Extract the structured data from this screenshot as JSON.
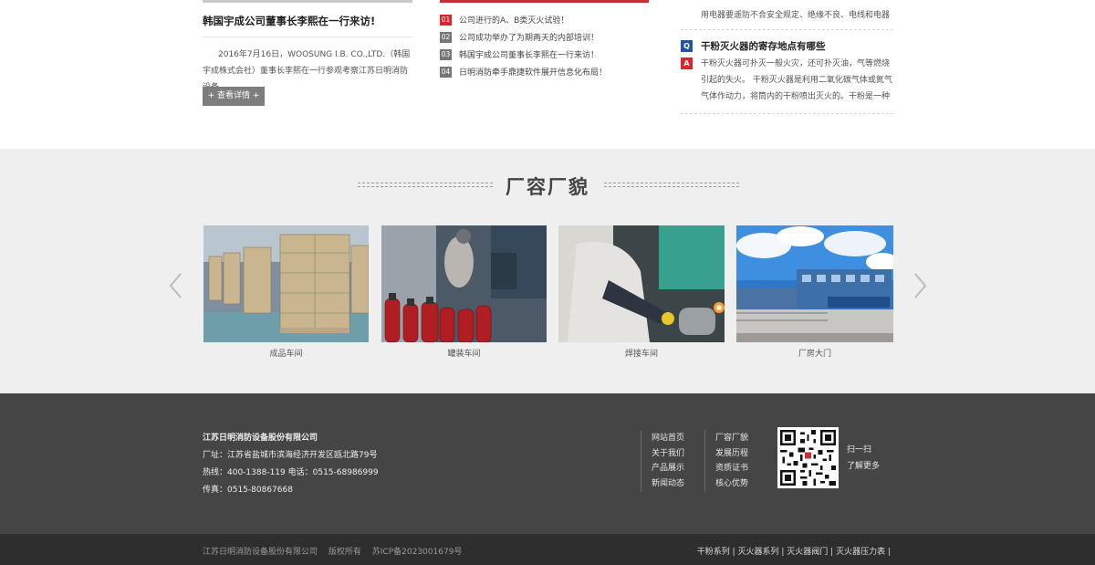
{
  "news": {
    "company": {
      "headline": "韩国宇成公司董事长李熙在一行来访!",
      "summary": "2016年7月16日，WOOSUNG I.B. CO.,LTD.（韩国宇成株式会社）董事长李熙在一行参观考察江苏日明消防设备",
      "more_label": "+ 查看详情 +"
    },
    "list": [
      {
        "num": "01",
        "title": "公司进行的A、B类灭火试验！"
      },
      {
        "num": "02",
        "title": "公司成功举办了为期两天的内部培训！"
      },
      {
        "num": "03",
        "title": "韩国宇成公司董事长李熙在一行来访！"
      },
      {
        "num": "04",
        "title": "日明消防牵手鼎捷软件展开信息化布局！"
      }
    ],
    "faq": {
      "prev_answer_tail": "用电器要遥防不合安全规定、绝缘不良、电线和电器",
      "q_badge": "Q",
      "question": "干粉灭火器的寄存地点有哪些",
      "a_badge": "A",
      "answer_lines": [
        "干粉灭火器可扑灭一般火灾，还可扑灭油，气等燃烧",
        "引起的失火。 干粉灭火器是利用二氧化碳气体或氮气",
        "气体作动力，将筒内的干粉喷出灭火的。干粉是一种"
      ]
    }
  },
  "gallery": {
    "title": "厂容厂貌",
    "items": [
      {
        "caption": "成品车间"
      },
      {
        "caption": "罐装车间"
      },
      {
        "caption": "焊接车间"
      },
      {
        "caption": "厂房大门"
      }
    ]
  },
  "footer": {
    "company": "江苏日明消防设备股份有限公司",
    "address": "厂址：江苏省盐城市滨海经济开发区瓯北路79号",
    "phone": "热线：400-1388-119    电话：0515-68986999",
    "fax": "传真：0515-80867668",
    "links_col1": [
      "网站首页",
      "关于我们",
      "产品展示",
      "新闻动态"
    ],
    "links_col2": [
      "厂容厂貌",
      "发展历程",
      "资质证书",
      "核心优势"
    ],
    "qr_line1": "扫一扫",
    "qr_line2": "了解更多",
    "copyright": "江苏日明消防设备股份有限公司",
    "rights": "版权所有",
    "icp": "苏ICP备2023001679号",
    "bottom_links": [
      "干粉系列",
      "灭火器系列",
      "灭火器阀门",
      "灭火器压力表"
    ]
  },
  "colors": {
    "accent_red": "#d8262c",
    "badge_blue": "#2551a6",
    "footer_bg": "#454545",
    "bottom_bg": "#2e2e2e",
    "gallery_bg": "#efefef"
  }
}
